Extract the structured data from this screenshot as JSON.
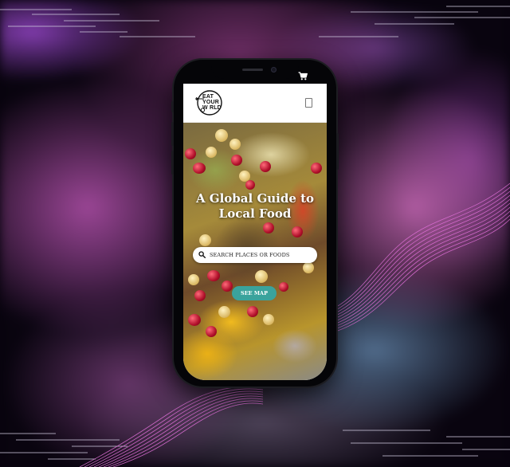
{
  "phone": {
    "statusbar": {
      "cart_icon": "cart-icon"
    },
    "header": {
      "logo_lines": [
        "EAT",
        "YOUR",
        "W RLD"
      ],
      "menu_icon": "menu-icon"
    },
    "hero": {
      "title": "A Global Guide to Local Food",
      "search": {
        "placeholder": "SEARCH PLACES OR FOODS",
        "icon": "search-icon"
      },
      "see_map_label": "SEE MAP"
    }
  },
  "colors": {
    "accent_button": "#3aa39c",
    "header_bg": "#ffffff",
    "phone_frame": "#050508"
  }
}
